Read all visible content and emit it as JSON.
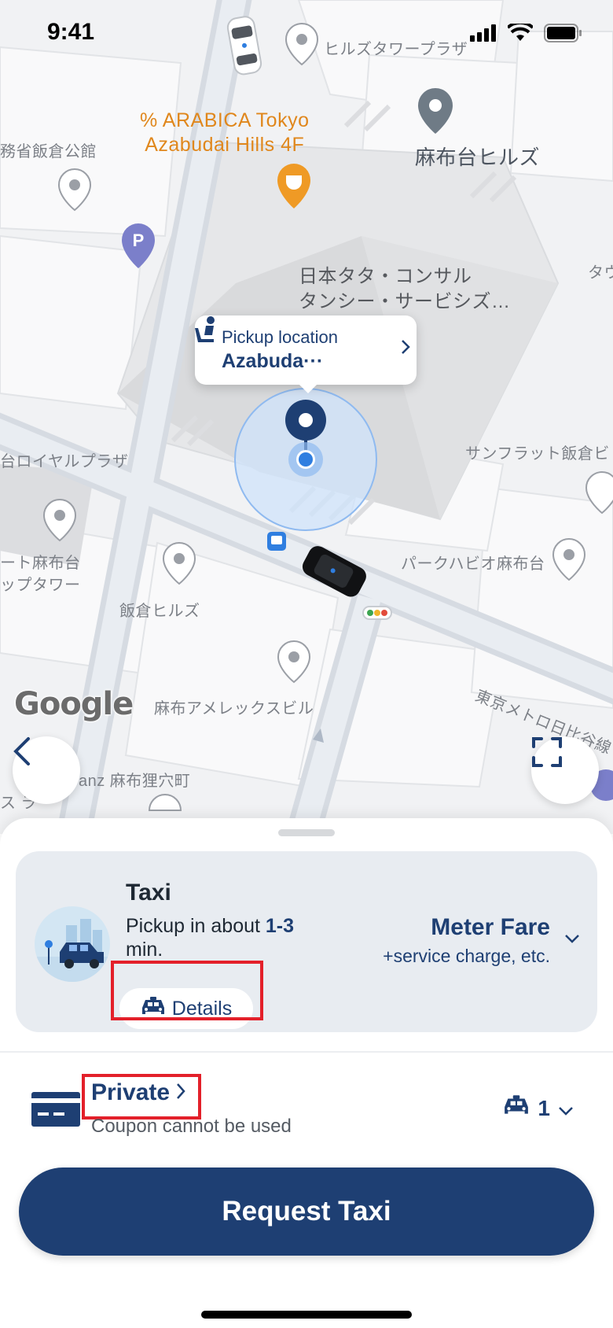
{
  "status_bar": {
    "time": "9:41"
  },
  "map": {
    "labels": {
      "hills_tower_plaza": "ヒルズタワープラザ",
      "arabica_line1": "% ARABICA Tokyo",
      "arabica_line2": "Azabudai Hills 4F",
      "azabudai_hills": "麻布台ヒルズ",
      "ministry": "務省飯倉公館",
      "nihon_line1": "日本タタ・コンサル",
      "nihon_line2": "タンシー・サービシズ…",
      "tau": "タウ",
      "royal_plaza": "台ロイヤルプラザ",
      "sunflat": "サンフラット飯倉ビ",
      "azabudai_tower_line1": "ート麻布台",
      "azabudai_tower_line2": "ップタワー",
      "park_habio": "パークハビオ麻布台",
      "iikura_hills": "飯倉ヒルズ",
      "azabu_amex": "麻布アメレックスビル",
      "metro_hibiya": "東京メトロ日比谷線",
      "anz": "anz 麻布狸穴町",
      "su": "ス ラ"
    },
    "google_logo": "Google",
    "pickup": {
      "title": "Pickup location",
      "name": "Azabuda···"
    }
  },
  "sheet": {
    "taxi": {
      "name": "Taxi",
      "eta_prefix": "Pickup in about ",
      "eta_value": "1-3",
      "eta_suffix": "min.",
      "details_label": "Details",
      "fare_title": "Meter Fare",
      "fare_sub": "+service charge, etc."
    },
    "payment": {
      "label": "Private",
      "coupon_text": "Coupon cannot be used"
    },
    "passengers": {
      "count": "1"
    },
    "request_button": "Request Taxi"
  },
  "colors": {
    "brand_navy": "#1e3f73",
    "highlight_red": "#e3202a",
    "map_bg": "#f1f2f4",
    "poi_orange": "#e0871c"
  }
}
